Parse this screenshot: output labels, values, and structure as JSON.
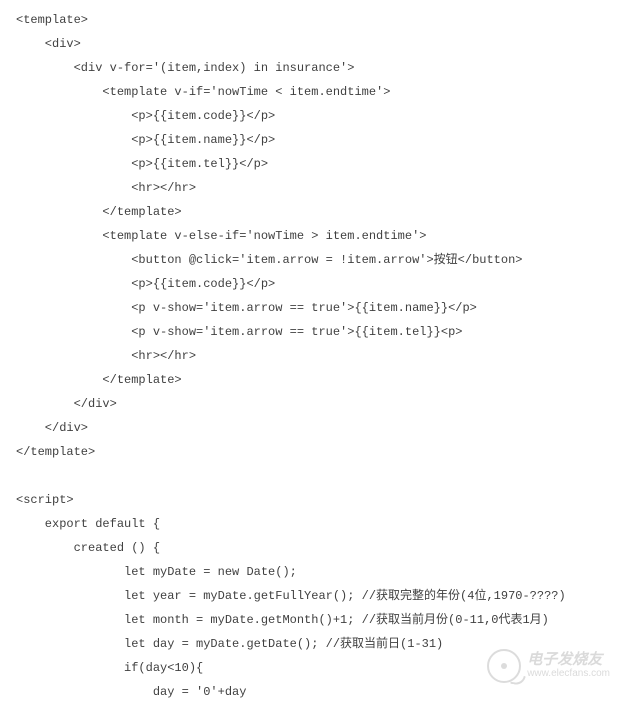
{
  "code": {
    "lines": [
      "<template>",
      "    <div>",
      "        <div v-for='(item,index) in insurance'>",
      "            <template v-if='nowTime < item.endtime'>",
      "                <p>{{item.code}}</p>",
      "                <p>{{item.name}}</p>",
      "                <p>{{item.tel}}</p>",
      "                <hr></hr>",
      "            </template>",
      "            <template v-else-if='nowTime > item.endtime'>",
      "                <button @click='item.arrow = !item.arrow'>按钮</button>",
      "                <p>{{item.code}}</p>",
      "                <p v-show='item.arrow == true'>{{item.name}}</p>",
      "                <p v-show='item.arrow == true'>{{item.tel}}<p>",
      "                <hr></hr>",
      "            </template>",
      "        </div>",
      "    </div>",
      "</template>",
      "",
      "<script>",
      "    export default {",
      "        created () {",
      "               let myDate = new Date();",
      "               let year = myDate.getFullYear(); //获取完整的年份(4位,1970-????)",
      "               let month = myDate.getMonth()+1; //获取当前月份(0-11,0代表1月)",
      "               let day = myDate.getDate(); //获取当前日(1-31)",
      "               if(day<10){",
      "                   day = '0'+day"
    ]
  },
  "watermark": {
    "title": "电子发烧友",
    "url": "www.elecfans.com"
  }
}
